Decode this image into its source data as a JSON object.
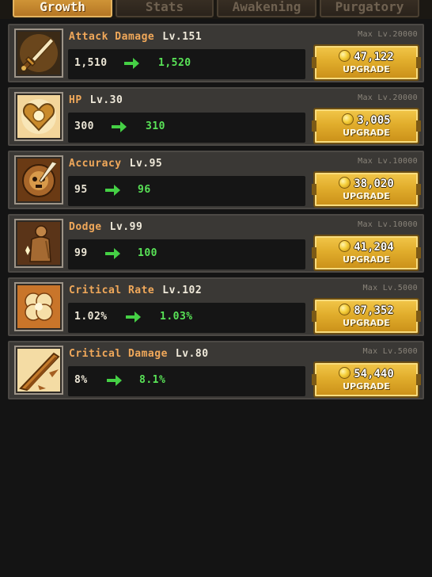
{
  "tabs": [
    {
      "label": "Growth",
      "active": true
    },
    {
      "label": "Stats",
      "active": false
    },
    {
      "label": "Awakening",
      "active": false
    },
    {
      "label": "Purgatory",
      "active": false
    }
  ],
  "rows": [
    {
      "name": "Attack Damage",
      "level": "Lv.151",
      "max": "Max Lv.20000",
      "current": "1,510",
      "next": "1,520",
      "cost": "47,122",
      "button": "UPGRADE",
      "icon": "sword-icon"
    },
    {
      "name": "HP",
      "level": "Lv.30",
      "max": "Max Lv.20000",
      "current": "300",
      "next": "310",
      "cost": "3,005",
      "button": "UPGRADE",
      "icon": "heart-icon"
    },
    {
      "name": "Accuracy",
      "level": "Lv.95",
      "max": "Max Lv.10000",
      "current": "95",
      "next": "96",
      "cost": "38,020",
      "button": "UPGRADE",
      "icon": "skull-target-icon"
    },
    {
      "name": "Dodge",
      "level": "Lv.99",
      "max": "Max Lv.10000",
      "current": "99",
      "next": "100",
      "cost": "41,204",
      "button": "UPGRADE",
      "icon": "figure-icon"
    },
    {
      "name": "Critical Rate",
      "level": "Lv.102",
      "max": "Max Lv.5000",
      "current": "1.02%",
      "next": "1.03%",
      "cost": "87,352",
      "button": "UPGRADE",
      "icon": "clover-icon"
    },
    {
      "name": "Critical Damage",
      "level": "Lv.80",
      "max": "Max Lv.5000",
      "current": "8%",
      "next": "8.1%",
      "cost": "54,440",
      "button": "UPGRADE",
      "icon": "blade-strike-icon"
    }
  ],
  "colors": {
    "name": "#f0a85a",
    "next_value": "#59e357",
    "button": "#e1ad2c",
    "panel": "#3a3835"
  }
}
